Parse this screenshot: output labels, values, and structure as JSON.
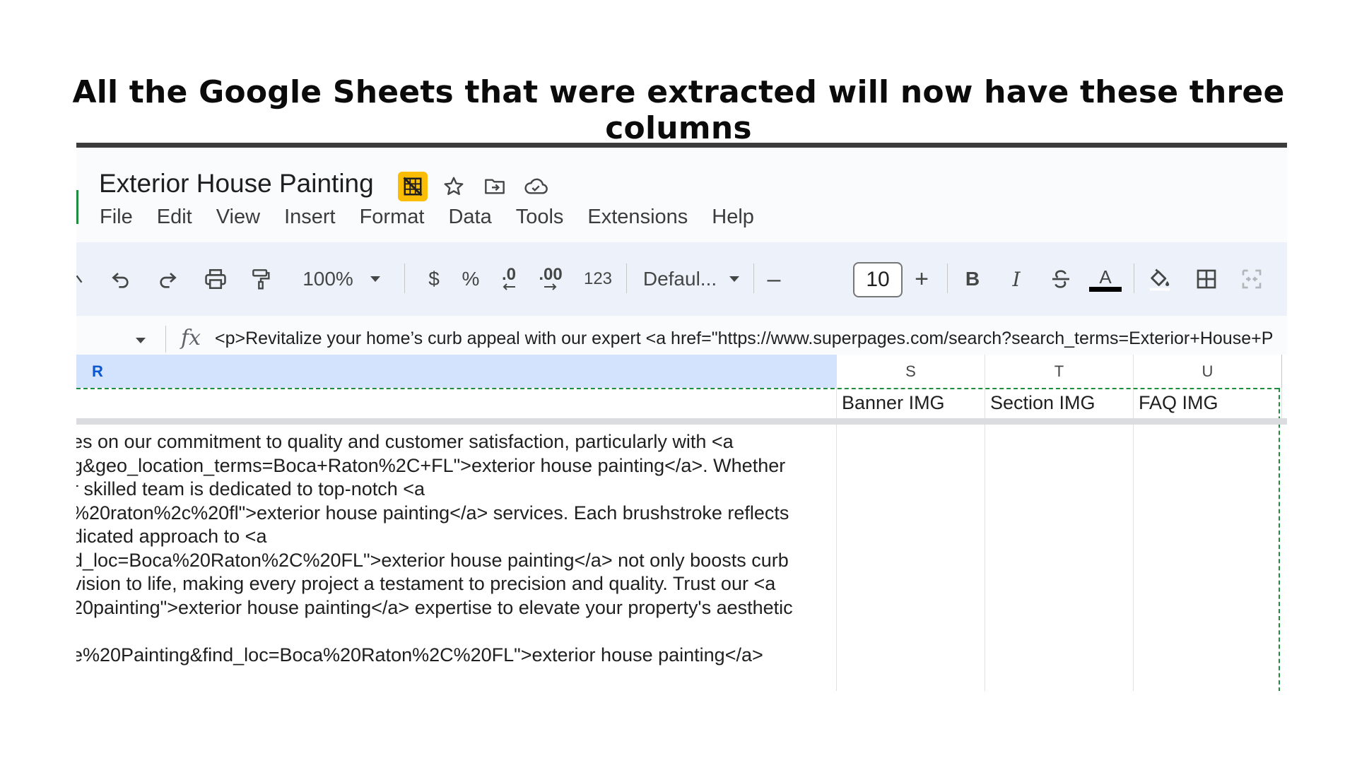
{
  "caption": "All the Google Sheets that were extracted will now have these three columns",
  "doc": {
    "title": "Exterior House Painting",
    "title_icons": [
      "hide-gridlines-icon",
      "star-icon",
      "move-to-folder-icon",
      "cloud-status-icon"
    ],
    "menu": [
      "File",
      "Edit",
      "View",
      "Insert",
      "Format",
      "Data",
      "Tools",
      "Extensions",
      "Help"
    ]
  },
  "toolbar": {
    "zoom": "100%",
    "currency": "$",
    "percent": "%",
    "decrease_decimal": ".0",
    "increase_decimal": ".00",
    "more_formats": "123",
    "font": "Defaul...",
    "font_size_minus": "–",
    "font_size": "10",
    "font_size_plus": "+",
    "bold": "B",
    "italic": "I",
    "text_color_letter": "A",
    "text_color": "#000000",
    "icons": [
      "collapse-icon",
      "undo-icon",
      "redo-icon",
      "print-icon",
      "paint-format-icon",
      "strikethrough-icon",
      "fill-color-icon",
      "borders-icon",
      "merge-cells-icon"
    ]
  },
  "formula_bar": {
    "fx": "fx",
    "content": "<p>Revitalize your home’s curb appeal with our expert <a href=\"https://www.superpages.com/search?search_terms=Exterior+House+P"
  },
  "columns": {
    "R": "R",
    "S": "S",
    "T": "T",
    "U": "U"
  },
  "header_row": {
    "S": "Banner IMG",
    "T": "Section IMG",
    "U": "FAQ IMG"
  },
  "cell_R2_lines": [
    "es on our commitment to quality and customer satisfaction, particularly with <a",
    "g&geo_location_terms=Boca+Raton%2C+FL\">exterior house painting</a>. Whether",
    "r skilled team is dedicated to top-notch <a",
    "%20raton%2c%20fl\">exterior house painting</a> services. Each brushstroke reflects",
    "dicated approach to <a",
    "d_loc=Boca%20Raton%2C%20FL\">exterior house painting</a> not only boosts curb",
    "vision to life, making every project a testament to precision and quality. Trust our <a",
    "20painting\">exterior house painting</a> expertise to elevate your property's aesthetic",
    "",
    "e%20Painting&find_loc=Boca%20Raton%2C%20FL\">exterior house painting</a>"
  ],
  "colors": {
    "selected_column_bg": "#d3e3fd",
    "toolbar_bg": "#edf2fa",
    "icon_highlight": "#fbbc04",
    "copy_border": "#1e8e3e"
  }
}
